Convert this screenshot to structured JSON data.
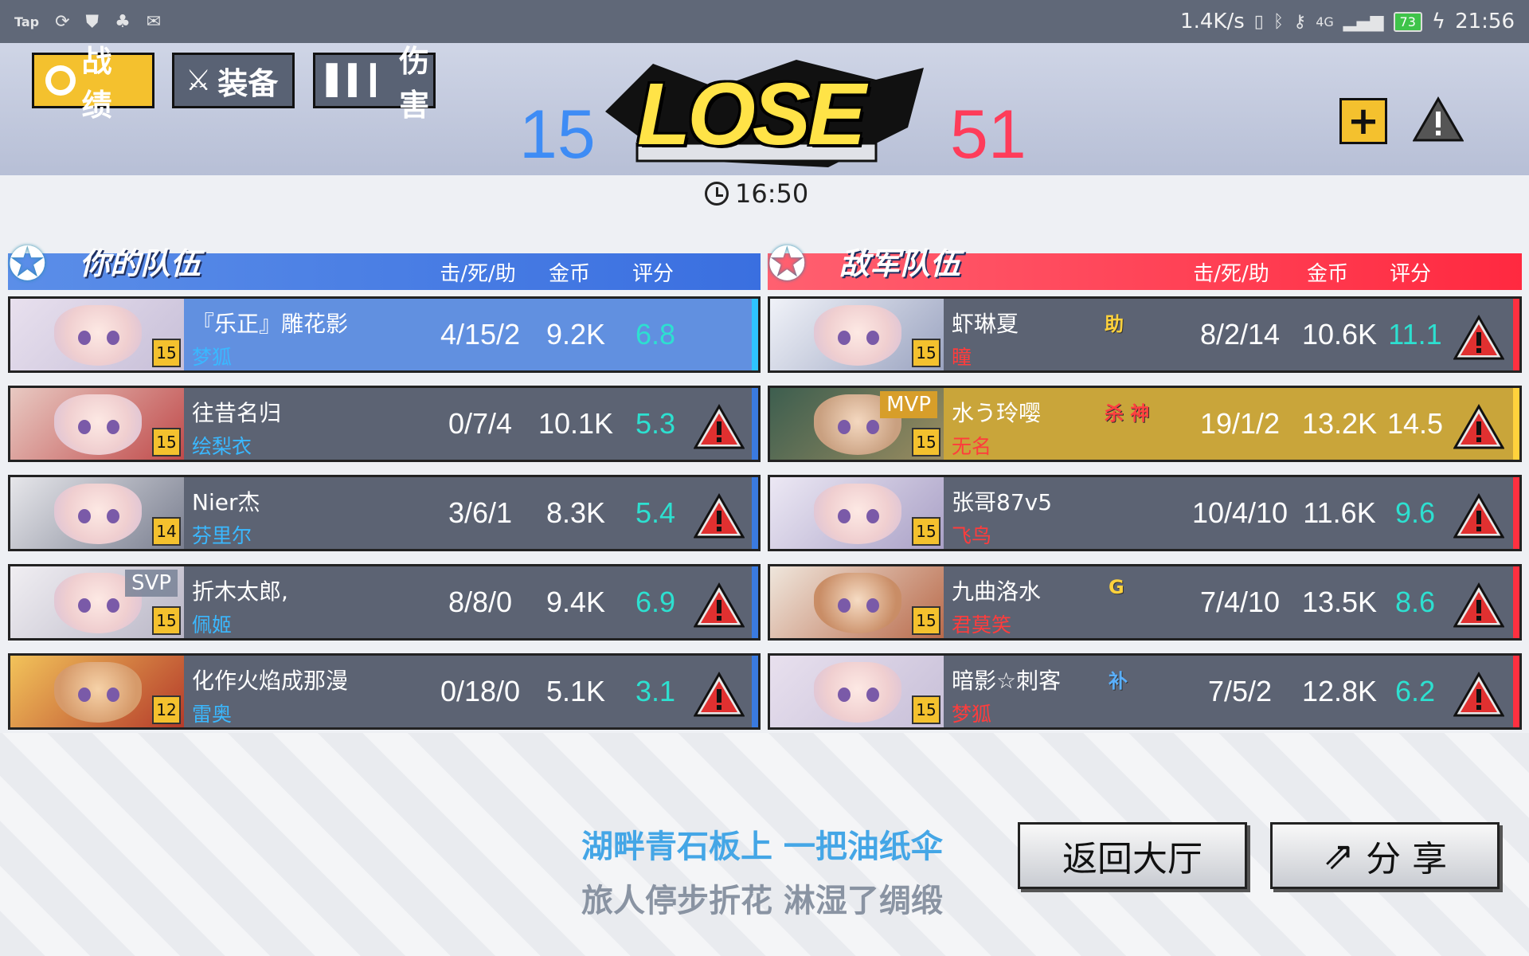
{
  "status_bar": {
    "left_icons": [
      "tap-icon",
      "sync-icon",
      "shield-icon",
      "qq-icon",
      "mail-icon"
    ],
    "tap_label": "Tap",
    "net_speed": "1.4K/s",
    "signal": "4G",
    "battery": "73",
    "time": "21:56"
  },
  "tabs": [
    {
      "label": "战绩",
      "icon": "circle-icon"
    },
    {
      "label": "装备",
      "icon": "sword-icon"
    },
    {
      "label": "伤害",
      "icon": "bar-chart-icon"
    }
  ],
  "match": {
    "result": "LOSE",
    "own_score": "15",
    "enemy_score": "51",
    "duration": "16:50"
  },
  "own_team": {
    "title": "你的队伍",
    "headers": [
      "击/死/助",
      "金币",
      "评分"
    ],
    "players": [
      {
        "name": "『乐正』雕花影",
        "hero": "梦狐",
        "level": "15",
        "kda": "4/15/2",
        "gold": "9.2K",
        "rating": "6.8",
        "self": true,
        "tag": ""
      },
      {
        "name": "往昔名归",
        "hero": "绘梨衣",
        "level": "15",
        "kda": "0/7/4",
        "gold": "10.1K",
        "rating": "5.3",
        "self": false,
        "tag": ""
      },
      {
        "name": "Nier杰",
        "hero": "芬里尔",
        "level": "14",
        "kda": "3/6/1",
        "gold": "8.3K",
        "rating": "5.4",
        "self": false,
        "tag": ""
      },
      {
        "name": "折木太郎,",
        "hero": "佩姬",
        "level": "15",
        "kda": "8/8/0",
        "gold": "9.4K",
        "rating": "6.9",
        "self": false,
        "tag": "SVP"
      },
      {
        "name": "化作火焰成那漫",
        "hero": "雷奥",
        "level": "12",
        "kda": "0/18/0",
        "gold": "5.1K",
        "rating": "3.1",
        "self": false,
        "tag": ""
      }
    ]
  },
  "enemy_team": {
    "title": "敌军队伍",
    "headers": [
      "击/死/助",
      "金币",
      "评分"
    ],
    "players": [
      {
        "name": "虾琳夏",
        "hero": "瞳",
        "level": "15",
        "kda": "8/2/14",
        "gold": "10.6K",
        "rating": "11.1",
        "tag": "",
        "badge": "助"
      },
      {
        "name": "水う玲嘤",
        "hero": "无名",
        "level": "15",
        "kda": "19/1/2",
        "gold": "13.2K",
        "rating": "14.5",
        "tag": "MVP",
        "badge": "杀 神"
      },
      {
        "name": "张哥87v5",
        "hero": "飞鸟",
        "level": "15",
        "kda": "10/4/10",
        "gold": "11.6K",
        "rating": "9.6",
        "tag": "",
        "badge": ""
      },
      {
        "name": "九曲洛水",
        "hero": "君莫笑",
        "level": "15",
        "kda": "7/4/10",
        "gold": "13.5K",
        "rating": "8.6",
        "tag": "",
        "badge": "G"
      },
      {
        "name": "暗影☆刺客",
        "hero": "梦狐",
        "level": "15",
        "kda": "7/5/2",
        "gold": "12.8K",
        "rating": "6.2",
        "tag": "",
        "badge": "补"
      }
    ]
  },
  "footer": {
    "lyric_line1": "湖畔青石板上 一把油纸伞",
    "lyric_line2": "旅人停步折花 淋湿了绸缎",
    "lobby_button": "返回大厅",
    "share_button": "分 享"
  },
  "colors": {
    "accent_yellow": "#f4c12e",
    "own_blue": "#3e8cf5",
    "enemy_red": "#ff3c5a",
    "rating_cyan": "#2de0d0"
  }
}
